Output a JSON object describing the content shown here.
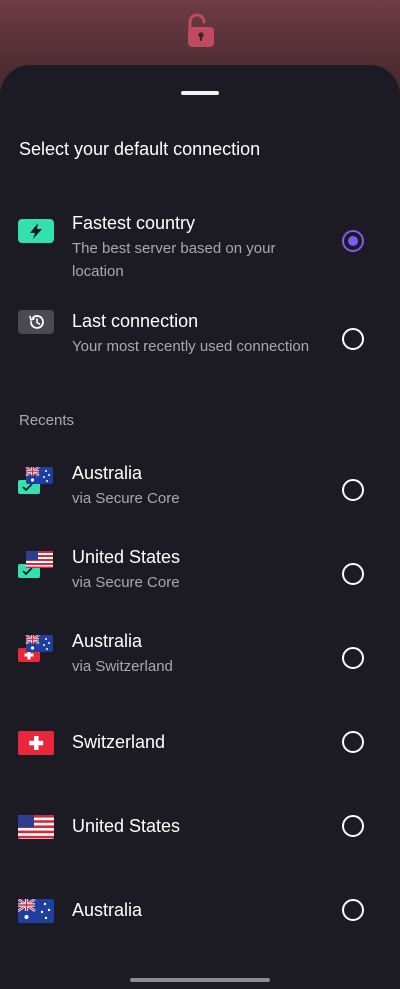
{
  "sheet": {
    "title": "Select your default connection"
  },
  "options": [
    {
      "label": "Fastest country",
      "description": "The best server based on your location",
      "icon": "bolt-icon",
      "selected": true
    },
    {
      "label": "Last connection",
      "description": "Your most recently used connection",
      "icon": "history-icon",
      "selected": false
    }
  ],
  "recents_header": "Recents",
  "recents": [
    {
      "country": "Australia",
      "via": "via Secure Core",
      "flag": "au",
      "entry": "secure-core"
    },
    {
      "country": "United States",
      "via": "via Secure Core",
      "flag": "us",
      "entry": "secure-core"
    },
    {
      "country": "Australia",
      "via": "via Switzerland",
      "flag": "au",
      "entry": "ch"
    },
    {
      "country": "Switzerland",
      "via": "",
      "flag": "ch",
      "entry": ""
    },
    {
      "country": "United States",
      "via": "",
      "flag": "us",
      "entry": ""
    },
    {
      "country": "Australia",
      "via": "",
      "flag": "au",
      "entry": ""
    }
  ],
  "colors": {
    "accent": "#7b5cf5",
    "sheet_bg": "#1c1b24",
    "secure_core": "#33e0b0",
    "lock": "#e04b63"
  }
}
